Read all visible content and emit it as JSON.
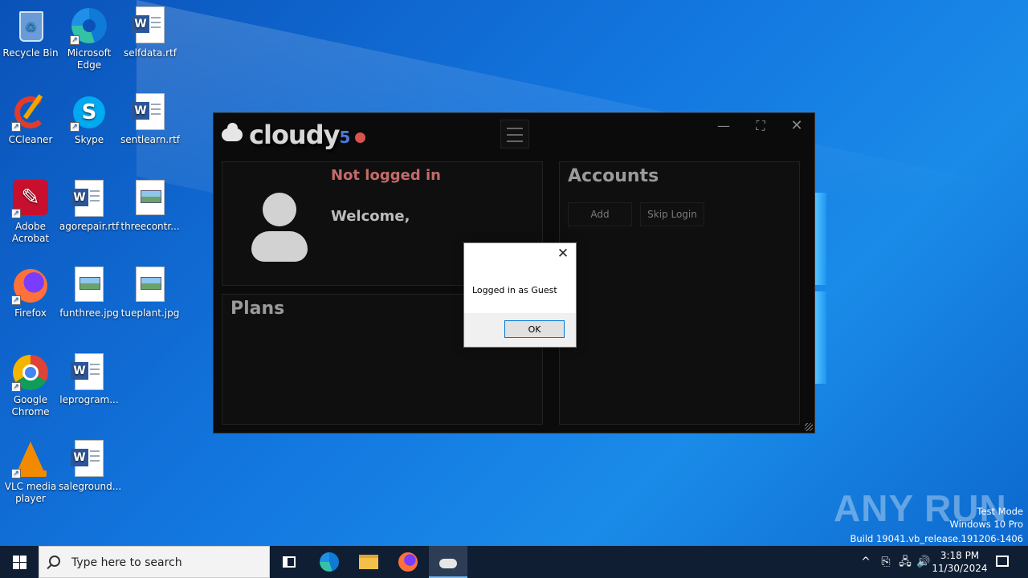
{
  "desktop": {
    "icons": [
      {
        "label": "Recycle Bin"
      },
      {
        "label": "Microsoft Edge"
      },
      {
        "label": "selfdata.rtf"
      },
      {
        "label": "CCleaner"
      },
      {
        "label": "Skype"
      },
      {
        "label": "sentlearn.rtf"
      },
      {
        "label": "Adobe Acrobat"
      },
      {
        "label": "agorepair.rtf"
      },
      {
        "label": "threecontr..."
      },
      {
        "label": "Firefox"
      },
      {
        "label": "funthree.jpg"
      },
      {
        "label": "tueplant.jpg"
      },
      {
        "label": "Google Chrome"
      },
      {
        "label": "leprogram..."
      },
      {
        "label": "VLC media player"
      },
      {
        "label": "saleground..."
      }
    ]
  },
  "app": {
    "brand": "cloudy",
    "version": "5",
    "status_color": "#d9534f",
    "controls": {
      "minimize": "—",
      "maximize": "⛶",
      "close": "✕"
    },
    "profile": {
      "status": "Not logged in",
      "welcome": "Welcome,"
    },
    "plans": {
      "title": "Plans"
    },
    "accounts": {
      "title": "Accounts",
      "add_label": "Add",
      "skip_label": "Skip Login"
    }
  },
  "dialog": {
    "message": "Logged in as Guest",
    "ok_label": "OK",
    "close": "✕"
  },
  "watermark": {
    "logo": "ANY RUN",
    "line1": "Test Mode",
    "line2": "Windows 10 Pro",
    "line3": "Build 19041.vb_release.191206-1406"
  },
  "taskbar": {
    "search_placeholder": "Type here to search",
    "time": "3:18 PM",
    "date": "11/30/2024",
    "accent": "#76b9ed"
  }
}
